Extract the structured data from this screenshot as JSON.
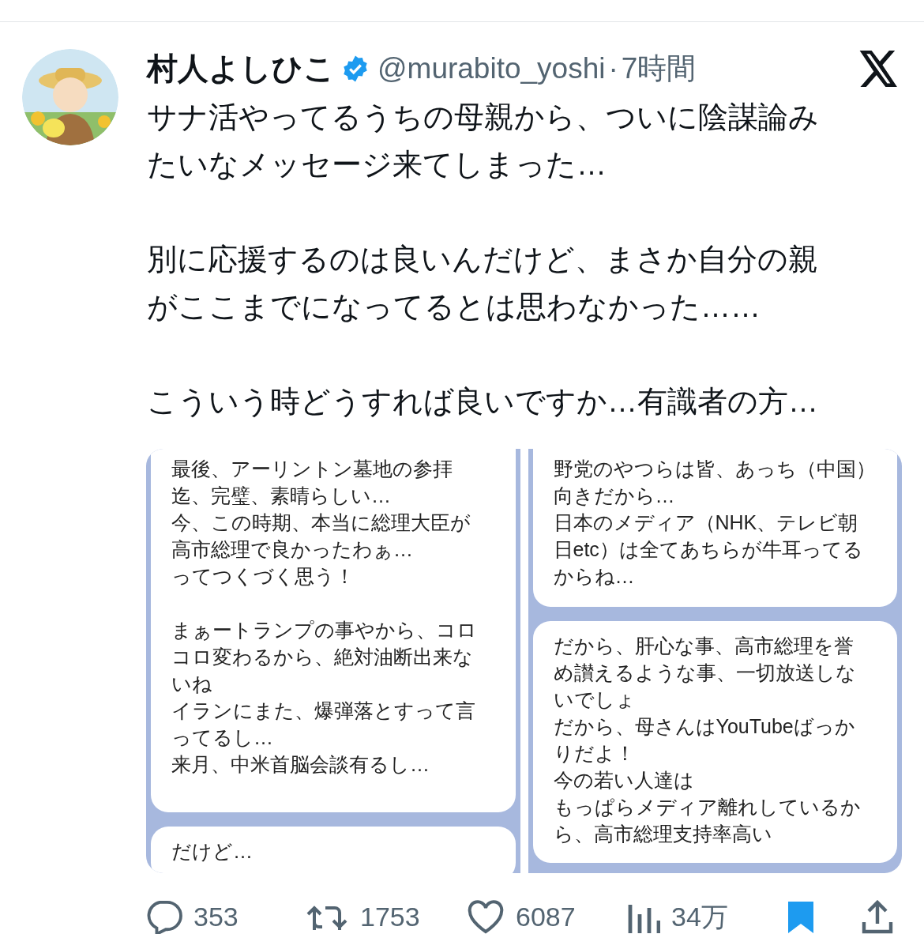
{
  "author": {
    "name": "村人よしひこ",
    "verified": true,
    "handle": "@murabito_yoshi",
    "separator": "·",
    "time": "7時間"
  },
  "body": [
    [
      "サナ活やってるうちの母親から、ついに陰謀論み",
      "たいなメッセージ来てしまった…"
    ],
    [
      "別に応援するのは良いんだけど、まさか自分の親",
      "がここまでになってるとは思わなかった……"
    ],
    [
      "こういう時どうすれば良いですか…有識者の方…"
    ]
  ],
  "attached_images": [
    {
      "kind": "screenshot",
      "messages": [
        {
          "paragraphs": [
            [
              "最後、アーリントン墓地の参拝",
              "迄、完璧、素晴らしい…",
              "今、この時期、本当に総理大臣が",
              "高市総理で良かったわぁ…",
              "ってつくづく思う！"
            ],
            [
              "まぁートランプの事やから、コロ",
              "コロ変わるから、絶対油断出来な",
              "いね",
              "イランにまた、爆弾落とすって言",
              "ってるし…",
              "来月、中米首脳会談有るし…"
            ]
          ]
        },
        {
          "paragraphs": [
            [
              "だけど…"
            ]
          ]
        }
      ]
    },
    {
      "kind": "screenshot",
      "messages": [
        {
          "paragraphs": [
            [
              "野党のやつらは皆、あっち（中国）",
              "向きだから…",
              "日本のメディア（NHK、テレビ朝",
              "日etc）は全てあちらが牛耳ってる",
              "からね…"
            ]
          ]
        },
        {
          "paragraphs": [
            [
              "だから、肝心な事、高市総理を誉",
              "め讃えるような事、一切放送しな",
              "いでしょ",
              "だから、母さんはYouTubeばっか",
              "りだよ！",
              "今の若い人達は",
              "もっぱらメディア離れしているか",
              "ら、高市総理支持率高い"
            ]
          ]
        }
      ]
    }
  ],
  "actions": [
    {
      "kind": "reply",
      "count": "353"
    },
    {
      "kind": "repost",
      "count": "1753"
    },
    {
      "kind": "like",
      "count": "6087"
    },
    {
      "kind": "views",
      "count": "34万"
    },
    {
      "kind": "bookmark",
      "bookmarked": true
    },
    {
      "kind": "share"
    }
  ]
}
